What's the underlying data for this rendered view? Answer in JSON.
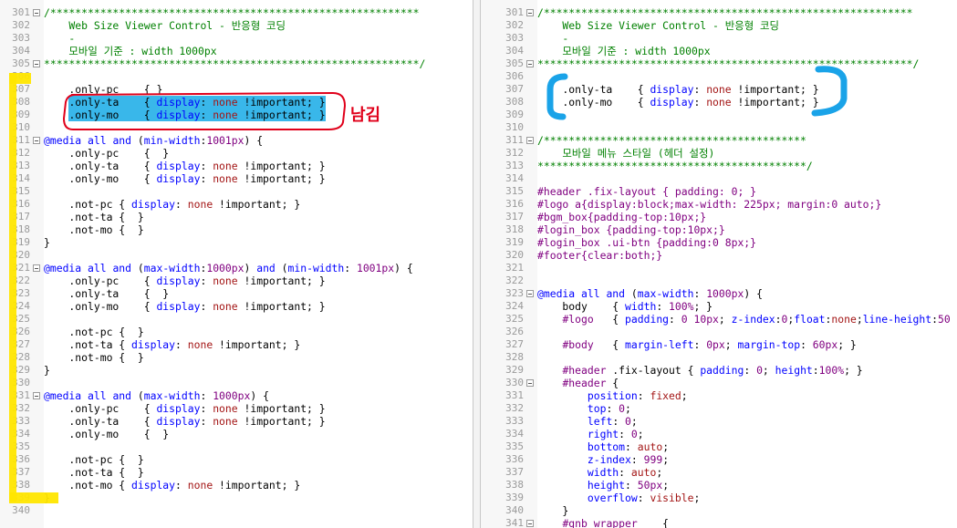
{
  "left": {
    "lines": [
      {
        "n": "301",
        "t": "/***********************************************************",
        "cls": "c-cm",
        "fold": true
      },
      {
        "n": "302",
        "t": "    Web Size Viewer Control - 반응형 코딩",
        "cls": "c-cm"
      },
      {
        "n": "303",
        "t": "    -",
        "cls": "c-cm"
      },
      {
        "n": "304",
        "t": "    모바일 기준 : width 1000px",
        "cls": "c-cm"
      },
      {
        "n": "305",
        "t": "************************************************************/",
        "cls": "c-cm",
        "fold": true
      },
      {
        "n": "306",
        "t": "",
        "cls": "c-bl"
      },
      {
        "n": "307",
        "t": "    .only-pc    { }",
        "cls": "c-bl"
      },
      {
        "n": "308",
        "t": "    .only-ta    { display: none !important; }",
        "cls": "c-bl",
        "sel": true
      },
      {
        "n": "309",
        "t": "    .only-mo    { display: none !important; }",
        "cls": "c-bl",
        "sel": true
      },
      {
        "n": "310",
        "t": "",
        "cls": "c-bl"
      },
      {
        "n": "311",
        "t": "@media all and (min-width:1001px) {",
        "cls": "c-bl",
        "fold": true
      },
      {
        "n": "312",
        "t": "    .only-pc    {  }",
        "cls": "c-bl"
      },
      {
        "n": "313",
        "t": "    .only-ta    { display: none !important; }",
        "cls": "c-bl"
      },
      {
        "n": "314",
        "t": "    .only-mo    { display: none !important; }",
        "cls": "c-bl"
      },
      {
        "n": "315",
        "t": "",
        "cls": "c-bl"
      },
      {
        "n": "316",
        "t": "    .not-pc { display: none !important; }",
        "cls": "c-bl"
      },
      {
        "n": "317",
        "t": "    .not-ta {  }",
        "cls": "c-bl"
      },
      {
        "n": "318",
        "t": "    .not-mo {  }",
        "cls": "c-bl"
      },
      {
        "n": "319",
        "t": "}",
        "cls": "c-bl"
      },
      {
        "n": "320",
        "t": "",
        "cls": "c-bl"
      },
      {
        "n": "321",
        "t": "@media all and (max-width:1000px) and (min-width: 1001px) {",
        "cls": "c-bl",
        "fold": true
      },
      {
        "n": "322",
        "t": "    .only-pc    { display: none !important; }",
        "cls": "c-bl"
      },
      {
        "n": "323",
        "t": "    .only-ta    {  }",
        "cls": "c-bl"
      },
      {
        "n": "324",
        "t": "    .only-mo    { display: none !important; }",
        "cls": "c-bl"
      },
      {
        "n": "325",
        "t": "",
        "cls": "c-bl"
      },
      {
        "n": "326",
        "t": "    .not-pc {  }",
        "cls": "c-bl"
      },
      {
        "n": "327",
        "t": "    .not-ta { display: none !important; }",
        "cls": "c-bl"
      },
      {
        "n": "328",
        "t": "    .not-mo {  }",
        "cls": "c-bl"
      },
      {
        "n": "329",
        "t": "}",
        "cls": "c-bl"
      },
      {
        "n": "330",
        "t": "",
        "cls": "c-bl"
      },
      {
        "n": "331",
        "t": "@media all and (max-width: 1000px) {",
        "cls": "c-bl",
        "fold": true
      },
      {
        "n": "332",
        "t": "    .only-pc    { display: none !important; }",
        "cls": "c-bl"
      },
      {
        "n": "333",
        "t": "    .only-ta    { display: none !important; }",
        "cls": "c-bl"
      },
      {
        "n": "334",
        "t": "    .only-mo    {  }",
        "cls": "c-bl"
      },
      {
        "n": "335",
        "t": "",
        "cls": "c-bl"
      },
      {
        "n": "336",
        "t": "    .not-pc {  }",
        "cls": "c-bl"
      },
      {
        "n": "337",
        "t": "    .not-ta {  }",
        "cls": "c-bl"
      },
      {
        "n": "338",
        "t": "    .not-mo { display: none !important; }",
        "cls": "c-bl"
      },
      {
        "n": "339",
        "t": "}",
        "cls": "c-bl"
      },
      {
        "n": "340",
        "t": "",
        "cls": "c-bl"
      }
    ]
  },
  "right": {
    "lines": [
      {
        "n": "301",
        "t": "/***********************************************************",
        "cls": "c-cm",
        "fold": true
      },
      {
        "n": "302",
        "t": "    Web Size Viewer Control - 반응형 코딩",
        "cls": "c-cm"
      },
      {
        "n": "303",
        "t": "    -",
        "cls": "c-cm"
      },
      {
        "n": "304",
        "t": "    모바일 기준 : width 1000px",
        "cls": "c-cm"
      },
      {
        "n": "305",
        "t": "************************************************************/",
        "cls": "c-cm",
        "fold": true
      },
      {
        "n": "306",
        "t": "",
        "cls": "c-bl"
      },
      {
        "n": "307",
        "t": "    .only-ta    { display: none !important; }",
        "cls": "c-bl"
      },
      {
        "n": "308",
        "t": "    .only-mo    { display: none !important; }",
        "cls": "c-bl"
      },
      {
        "n": "309",
        "t": "",
        "cls": "c-bl"
      },
      {
        "n": "310",
        "t": "",
        "cls": "c-bl"
      },
      {
        "n": "311",
        "t": "/******************************************",
        "cls": "c-cm",
        "fold": true
      },
      {
        "n": "312",
        "t": "    모바일 메뉴 스타일 (헤더 설정)",
        "cls": "c-cm"
      },
      {
        "n": "313",
        "t": "*******************************************/",
        "cls": "c-cm"
      },
      {
        "n": "314",
        "t": "",
        "cls": "c-bl"
      },
      {
        "n": "315",
        "t": "#header .fix-layout { padding: 0; }",
        "cls": "c-nm"
      },
      {
        "n": "316",
        "t": "#logo a{display:block;max-width: 225px; margin:0 auto;}",
        "cls": "c-nm"
      },
      {
        "n": "317",
        "t": "#bgm_box{padding-top:10px;}",
        "cls": "c-nm"
      },
      {
        "n": "318",
        "t": "#login_box {padding-top:10px;}",
        "cls": "c-nm"
      },
      {
        "n": "319",
        "t": "#login_box .ui-btn {padding:0 8px;}",
        "cls": "c-nm"
      },
      {
        "n": "320",
        "t": "#footer{clear:both;}",
        "cls": "c-nm"
      },
      {
        "n": "321",
        "t": "",
        "cls": "c-bl"
      },
      {
        "n": "322",
        "t": "",
        "cls": "c-bl"
      },
      {
        "n": "323",
        "t": "@media all and (max-width: 1000px) {",
        "cls": "c-bl",
        "fold": true
      },
      {
        "n": "324",
        "t": "    body    { width: 100%; }",
        "cls": "c-bl"
      },
      {
        "n": "325",
        "t": "    #logo   { padding: 0 10px; z-index:0;float:none;line-height:50",
        "cls": "c-bl"
      },
      {
        "n": "326",
        "t": "",
        "cls": "c-bl"
      },
      {
        "n": "327",
        "t": "    #body   { margin-left: 0px; margin-top: 60px; }",
        "cls": "c-bl"
      },
      {
        "n": "328",
        "t": "",
        "cls": "c-bl"
      },
      {
        "n": "329",
        "t": "    #header .fix-layout { padding: 0; height:100%; }",
        "cls": "c-bl"
      },
      {
        "n": "330",
        "t": "    #header {",
        "cls": "c-bl",
        "fold": true
      },
      {
        "n": "331",
        "t": "        position: fixed;",
        "cls": "c-bl"
      },
      {
        "n": "332",
        "t": "        top: 0;",
        "cls": "c-bl"
      },
      {
        "n": "333",
        "t": "        left: 0;",
        "cls": "c-bl"
      },
      {
        "n": "334",
        "t": "        right: 0;",
        "cls": "c-bl"
      },
      {
        "n": "335",
        "t": "        bottom: auto;",
        "cls": "c-bl"
      },
      {
        "n": "336",
        "t": "        z-index: 999;",
        "cls": "c-bl"
      },
      {
        "n": "337",
        "t": "        width: auto;",
        "cls": "c-bl"
      },
      {
        "n": "338",
        "t": "        height: 50px;",
        "cls": "c-bl"
      },
      {
        "n": "339",
        "t": "        overflow: visible;",
        "cls": "c-bl"
      },
      {
        "n": "340",
        "t": "    }",
        "cls": "c-bl"
      },
      {
        "n": "341",
        "t": "    #gnb_wrapper    {",
        "cls": "c-bl",
        "fold": true
      }
    ]
  },
  "annotation": {
    "text": "남김"
  },
  "colors": {
    "selection": "#39b7ea",
    "marker_yellow": "#ffe600",
    "marker_blue": "#1aa3e8",
    "marker_red": "#e0001a"
  }
}
